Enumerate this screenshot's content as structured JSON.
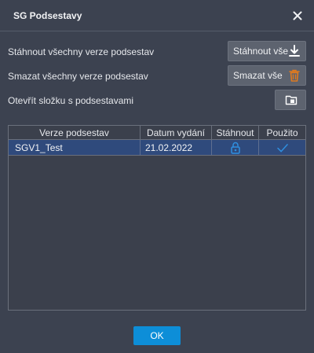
{
  "dialog": {
    "title": "SG Podsestavy",
    "close_icon": "close-icon"
  },
  "actions": [
    {
      "label": "Stáhnout všechny verze podsestav",
      "button_label": "Stáhnout vše",
      "icon": "download-icon"
    },
    {
      "label": "Smazat všechny verze podsestav",
      "button_label": "Smazat vše",
      "icon": "trash-icon"
    },
    {
      "label": "Otevřít složku s podsestavami",
      "button_label": "",
      "icon": "folder-icon"
    }
  ],
  "table": {
    "columns": [
      "Verze podsestav",
      "Datum vydání",
      "Stáhnout",
      "Použito"
    ],
    "rows": [
      {
        "version": "SGV1_Test",
        "date": "21.02.2022",
        "download": "unlock-icon",
        "used": "checkmark-icon"
      }
    ]
  },
  "footer": {
    "ok_label": "OK"
  },
  "colors": {
    "background": "#3c4250",
    "selected_row": "#2f4a7c",
    "accent": "#0d8ed8",
    "trash": "#e07a1f",
    "icon_blue": "#2f8fe0"
  }
}
